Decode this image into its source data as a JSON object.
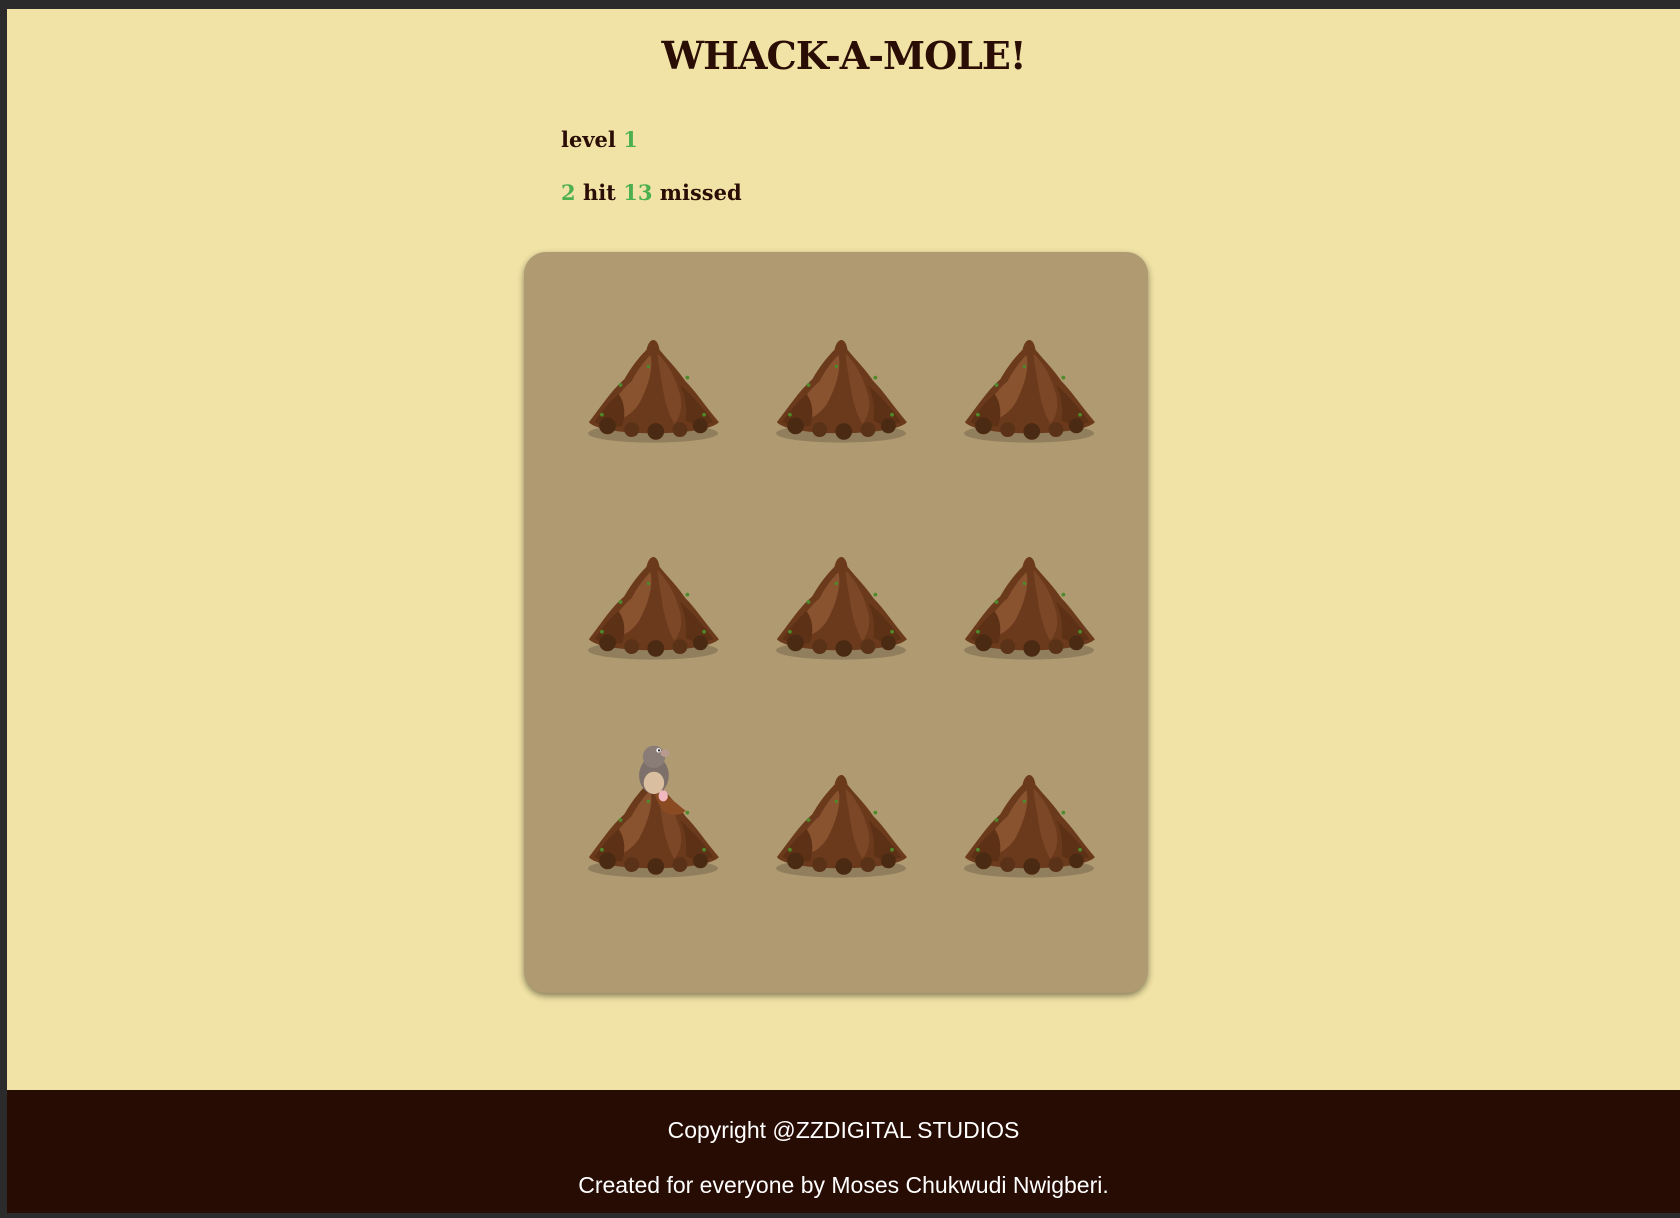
{
  "game": {
    "title": "WHACK-A-MOLE!",
    "level_label": "level",
    "level_value": "1",
    "hit_value": "2",
    "hit_label": "hit",
    "missed_value": "13",
    "missed_label": "missed"
  },
  "board": {
    "rows": 3,
    "cols": 3,
    "mole_visible_at_hole": 7,
    "holes": [
      {
        "index": 1,
        "has_mole": false
      },
      {
        "index": 2,
        "has_mole": false
      },
      {
        "index": 3,
        "has_mole": false
      },
      {
        "index": 4,
        "has_mole": false
      },
      {
        "index": 5,
        "has_mole": false
      },
      {
        "index": 6,
        "has_mole": false
      },
      {
        "index": 7,
        "has_mole": true
      },
      {
        "index": 8,
        "has_mole": false
      },
      {
        "index": 9,
        "has_mole": false
      }
    ]
  },
  "footer": {
    "copyright": "Copyright @ZZDIGITAL STUDIOS",
    "credit": "Created for everyone by Moses Chukwudi Nwigberi."
  },
  "colors": {
    "page_background": "#f1e3a5",
    "board_background": "#af9a72",
    "footer_background": "#260c03",
    "title_text": "#2a0d05",
    "number_accent": "#4caf50",
    "dirt": "#6b3a1c"
  }
}
